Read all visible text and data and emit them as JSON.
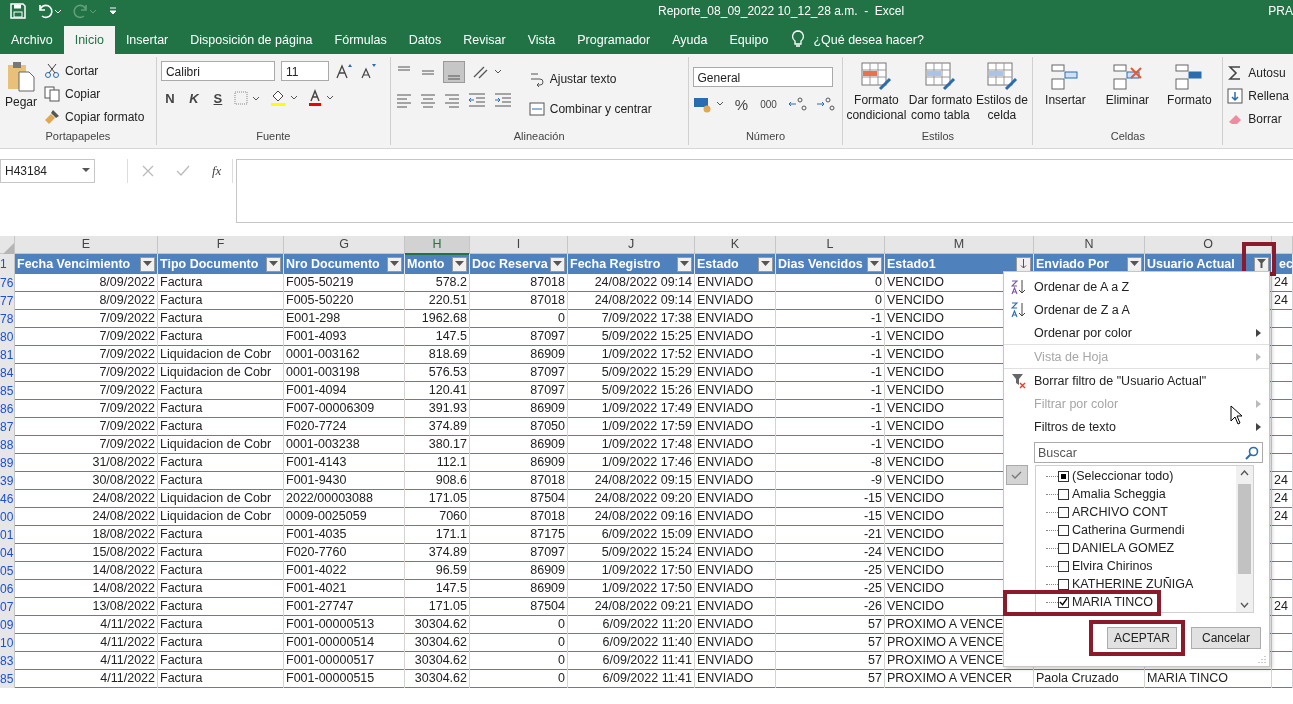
{
  "title_bar": {
    "title": "Reporte_08_09_2022 10_12_28 a.m.  -  Excel",
    "user": "PRA"
  },
  "ribbon_tabs": [
    {
      "label": "Archivo",
      "selected": false
    },
    {
      "label": "Inicio",
      "selected": true
    },
    {
      "label": "Insertar",
      "selected": false
    },
    {
      "label": "Disposición de página",
      "selected": false
    },
    {
      "label": "Fórmulas",
      "selected": false
    },
    {
      "label": "Datos",
      "selected": false
    },
    {
      "label": "Revisar",
      "selected": false
    },
    {
      "label": "Vista",
      "selected": false
    },
    {
      "label": "Programador",
      "selected": false
    },
    {
      "label": "Ayuda",
      "selected": false
    },
    {
      "label": "Equipo",
      "selected": false
    }
  ],
  "tell_me": "¿Qué desea hacer?",
  "clipboard": {
    "paste": "Pegar",
    "cut": "Cortar",
    "copy": "Copiar",
    "format_painter": "Copiar formato",
    "label": "Portapapeles"
  },
  "font": {
    "name": "Calibri",
    "size": "11",
    "bold": "N",
    "italic": "K",
    "underline": "S",
    "label": "Fuente"
  },
  "alignment": {
    "wrap": "Ajustar texto",
    "merge": "Combinar y centrar",
    "label": "Alineación"
  },
  "number": {
    "format": "General",
    "percent": "%",
    "thousands": "000",
    "label": "Número"
  },
  "styles": {
    "buttons": [
      [
        "Formato",
        "condicional"
      ],
      [
        "Dar formato",
        "como tabla"
      ],
      [
        "Estilos de",
        "celda"
      ]
    ],
    "label": "Estilos"
  },
  "cells": {
    "buttons": [
      "Insertar",
      "Eliminar",
      "Formato"
    ],
    "label": "Celdas"
  },
  "editing": {
    "buttons": [
      "Autosu",
      "Rellena",
      "Borrar"
    ]
  },
  "formula_bar": {
    "name_box": "H43184",
    "fx": "fx"
  },
  "column_letters": [
    {
      "letter": "E",
      "selected": false
    },
    {
      "letter": "F",
      "selected": false
    },
    {
      "letter": "G",
      "selected": false
    },
    {
      "letter": "H",
      "selected": true
    },
    {
      "letter": "I",
      "selected": false
    },
    {
      "letter": "J",
      "selected": false
    },
    {
      "letter": "K",
      "selected": false
    },
    {
      "letter": "L",
      "selected": false
    },
    {
      "letter": "M",
      "selected": false
    },
    {
      "letter": "N",
      "selected": false
    },
    {
      "letter": "O",
      "selected": false
    }
  ],
  "table": {
    "header_row_number": "1",
    "rows_filtered": true,
    "columns": [
      {
        "label": "Fecha Vencimiento",
        "numeric": true,
        "filter_button": true,
        "sorted": false,
        "filtered": false,
        "highlighted": false
      },
      {
        "label": "Tipo Documento",
        "numeric": false,
        "filter_button": true,
        "sorted": false,
        "filtered": false,
        "highlighted": false
      },
      {
        "label": "Nro Documento",
        "numeric": false,
        "filter_button": true,
        "sorted": false,
        "filtered": false,
        "highlighted": false
      },
      {
        "label": "Monto",
        "numeric": true,
        "filter_button": true,
        "sorted": false,
        "filtered": false,
        "highlighted": false
      },
      {
        "label": "Doc Reserva",
        "numeric": true,
        "filter_button": true,
        "sorted": false,
        "filtered": false,
        "highlighted": false
      },
      {
        "label": "Fecha Registro",
        "numeric": true,
        "filter_button": true,
        "sorted": false,
        "filtered": false,
        "highlighted": false
      },
      {
        "label": "Estado",
        "numeric": false,
        "filter_button": true,
        "sorted": false,
        "filtered": false,
        "highlighted": false
      },
      {
        "label": "Dias Vencidos",
        "numeric": true,
        "filter_button": true,
        "sorted": false,
        "filtered": false,
        "highlighted": false
      },
      {
        "label": "Estado1",
        "numeric": false,
        "filter_button": true,
        "sorted": true,
        "filtered": false,
        "highlighted": false
      },
      {
        "label": "Enviado Por",
        "numeric": false,
        "filter_button": true,
        "sorted": false,
        "filtered": false,
        "highlighted": false
      },
      {
        "label": "Usuario Actual",
        "numeric": false,
        "filter_button": true,
        "sorted": false,
        "filtered": true,
        "highlighted": true
      },
      {
        "label": "ec",
        "filter_button": false,
        "highlighted": false
      }
    ],
    "rows": [
      {
        "num": "76",
        "cells": [
          "8/09/2022",
          "Factura",
          "F005-50219",
          "578.2",
          "87018",
          "24/08/2022 09:14",
          "ENVIADO",
          "0",
          "VENCIDO",
          null,
          null,
          "24"
        ]
      },
      {
        "num": "77",
        "cells": [
          "8/09/2022",
          "Factura",
          "F005-50220",
          "220.51",
          "87018",
          "24/08/2022 09:14",
          "ENVIADO",
          "0",
          "VENCIDO",
          null,
          null,
          "24"
        ]
      },
      {
        "num": "78",
        "cells": [
          "7/09/2022",
          "Factura",
          "E001-298",
          "1962.68",
          "0",
          "7/09/2022 17:38",
          "ENVIADO",
          "-1",
          "VENCIDO",
          null,
          null,
          null
        ]
      },
      {
        "num": "80",
        "cells": [
          "7/09/2022",
          "Factura",
          "F001-4093",
          "147.5",
          "87097",
          "5/09/2022 15:25",
          "ENVIADO",
          "-1",
          "VENCIDO",
          null,
          null,
          null
        ]
      },
      {
        "num": "81",
        "cells": [
          "7/09/2022",
          "Liquidacion de Cobr",
          "0001-003162",
          "818.69",
          "86909",
          "1/09/2022 17:52",
          "ENVIADO",
          "-1",
          "VENCIDO",
          null,
          null,
          null
        ]
      },
      {
        "num": "84",
        "cells": [
          "7/09/2022",
          "Liquidacion de Cobr",
          "0001-003198",
          "576.53",
          "87097",
          "5/09/2022 15:29",
          "ENVIADO",
          "-1",
          "VENCIDO",
          null,
          null,
          null
        ]
      },
      {
        "num": "85",
        "cells": [
          "7/09/2022",
          "Factura",
          "F001-4094",
          "120.41",
          "87097",
          "5/09/2022 15:26",
          "ENVIADO",
          "-1",
          "VENCIDO",
          null,
          null,
          null
        ]
      },
      {
        "num": "86",
        "cells": [
          "7/09/2022",
          "Factura",
          "F007-00006309",
          "391.93",
          "86909",
          "1/09/2022 17:49",
          "ENVIADO",
          "-1",
          "VENCIDO",
          null,
          null,
          null
        ]
      },
      {
        "num": "87",
        "cells": [
          "7/09/2022",
          "Factura",
          "F020-7724",
          "374.89",
          "87050",
          "1/09/2022 17:59",
          "ENVIADO",
          "-1",
          "VENCIDO",
          null,
          null,
          null
        ]
      },
      {
        "num": "88",
        "cells": [
          "7/09/2022",
          "Liquidacion de Cobr",
          "0001-003238",
          "380.17",
          "86909",
          "1/09/2022 17:48",
          "ENVIADO",
          "-1",
          "VENCIDO",
          null,
          null,
          null
        ]
      },
      {
        "num": "89",
        "cells": [
          "31/08/2022",
          "Factura",
          "F001-4143",
          "112.1",
          "86909",
          "1/09/2022 17:46",
          "ENVIADO",
          "-8",
          "VENCIDO",
          null,
          null,
          null
        ]
      },
      {
        "num": "39",
        "cells": [
          "30/08/2022",
          "Factura",
          "F001-9430",
          "908.6",
          "87018",
          "24/08/2022 09:15",
          "ENVIADO",
          "-9",
          "VENCIDO",
          null,
          null,
          "24"
        ]
      },
      {
        "num": "46",
        "cells": [
          "24/08/2022",
          "Liquidacion de Cobr",
          "2022/00003088",
          "171.05",
          "87504",
          "24/08/2022 09:20",
          "ENVIADO",
          "-15",
          "VENCIDO",
          null,
          null,
          "24"
        ]
      },
      {
        "num": "00",
        "cells": [
          "24/08/2022",
          "Liquidacion de Cobr",
          "0009-0025059",
          "7060",
          "87018",
          "24/08/2022 09:16",
          "ENVIADO",
          "-15",
          "VENCIDO",
          null,
          null,
          "24"
        ]
      },
      {
        "num": "01",
        "cells": [
          "18/08/2022",
          "Factura",
          "F001-4035",
          "171.1",
          "87175",
          "6/09/2022 15:09",
          "ENVIADO",
          "-21",
          "VENCIDO",
          null,
          null,
          null
        ]
      },
      {
        "num": "04",
        "cells": [
          "15/08/2022",
          "Factura",
          "F020-7760",
          "374.89",
          "87097",
          "5/09/2022 15:24",
          "ENVIADO",
          "-24",
          "VENCIDO",
          null,
          null,
          null
        ]
      },
      {
        "num": "05",
        "cells": [
          "14/08/2022",
          "Factura",
          "F001-4022",
          "96.59",
          "86909",
          "1/09/2022 17:50",
          "ENVIADO",
          "-25",
          "VENCIDO",
          null,
          null,
          null
        ]
      },
      {
        "num": "06",
        "cells": [
          "14/08/2022",
          "Factura",
          "F001-4021",
          "147.5",
          "86909",
          "1/09/2022 17:50",
          "ENVIADO",
          "-25",
          "VENCIDO",
          null,
          null,
          null
        ]
      },
      {
        "num": "07",
        "cells": [
          "13/08/2022",
          "Factura",
          "F001-27747",
          "171.05",
          "87504",
          "24/08/2022 09:21",
          "ENVIADO",
          "-26",
          "VENCIDO",
          null,
          null,
          "24"
        ]
      },
      {
        "num": "09",
        "cells": [
          "4/11/2022",
          "Factura",
          "F001-00000513",
          "30304.62",
          "0",
          "6/09/2022 11:20",
          "ENVIADO",
          "57",
          "PROXIMO A VENCE",
          null,
          null,
          null
        ]
      },
      {
        "num": "10",
        "cells": [
          "4/11/2022",
          "Factura",
          "F001-00000514",
          "30304.62",
          "0",
          "6/09/2022 11:40",
          "ENVIADO",
          "57",
          "PROXIMO A VENCE",
          null,
          null,
          null
        ]
      },
      {
        "num": "83",
        "cells": [
          "4/11/2022",
          "Factura",
          "F001-00000517",
          "30304.62",
          "0",
          "6/09/2022 11:41",
          "ENVIADO",
          "57",
          "PROXIMO A VENCE",
          null,
          null,
          null
        ]
      },
      {
        "num": "85",
        "cells": [
          "4/11/2022",
          "Factura",
          "F001-00000515",
          "30304.62",
          "0",
          "6/09/2022 11:41",
          "ENVIADO",
          "57",
          "PROXIMO A VENCER",
          "Paola Cruzado",
          "MARIA TINCO",
          null
        ]
      }
    ]
  },
  "filter_menu": {
    "items": [
      {
        "label": "Ordenar de A a Z",
        "kind": "sort-asc",
        "disabled": false,
        "submenu": false,
        "divider_above": false
      },
      {
        "label": "Ordenar de Z a A",
        "kind": "sort-desc",
        "disabled": false,
        "submenu": false,
        "divider_above": false
      },
      {
        "label": "Ordenar por color",
        "kind": "plain",
        "disabled": false,
        "submenu": true,
        "divider_above": false
      },
      {
        "label": "Vista de Hoja",
        "kind": "plain",
        "disabled": true,
        "submenu": true,
        "divider_above": true
      },
      {
        "label": "Borrar filtro de \"Usuario Actual\"",
        "kind": "clear-filter",
        "disabled": false,
        "submenu": false,
        "divider_above": true
      },
      {
        "label": "Filtrar por color",
        "kind": "plain",
        "disabled": true,
        "submenu": true,
        "divider_above": false
      },
      {
        "label": "Filtros de texto",
        "kind": "plain",
        "disabled": false,
        "submenu": true,
        "divider_above": false
      }
    ],
    "search": {
      "placeholder": "Buscar"
    },
    "values": [
      {
        "label": "(Seleccionar todo)",
        "checked": false,
        "indeterminate": true,
        "highlighted": false
      },
      {
        "label": "Amalia Scheggia",
        "checked": false,
        "indeterminate": false,
        "highlighted": false
      },
      {
        "label": "ARCHIVO CONT",
        "checked": false,
        "indeterminate": false,
        "highlighted": false
      },
      {
        "label": "Catherina Gurmendi",
        "checked": false,
        "indeterminate": false,
        "highlighted": false
      },
      {
        "label": "DANIELA GOMEZ",
        "checked": false,
        "indeterminate": false,
        "highlighted": false
      },
      {
        "label": "Elvira Chirinos",
        "checked": false,
        "indeterminate": false,
        "highlighted": false
      },
      {
        "label": "KATHERINE ZUÑIGA",
        "checked": false,
        "indeterminate": false,
        "highlighted": false
      },
      {
        "label": "MARIA TINCO",
        "checked": true,
        "indeterminate": false,
        "highlighted": true
      }
    ],
    "buttons": [
      {
        "label": "ACEPTAR",
        "highlighted": true
      },
      {
        "label": "Cancelar",
        "highlighted": false
      }
    ]
  }
}
